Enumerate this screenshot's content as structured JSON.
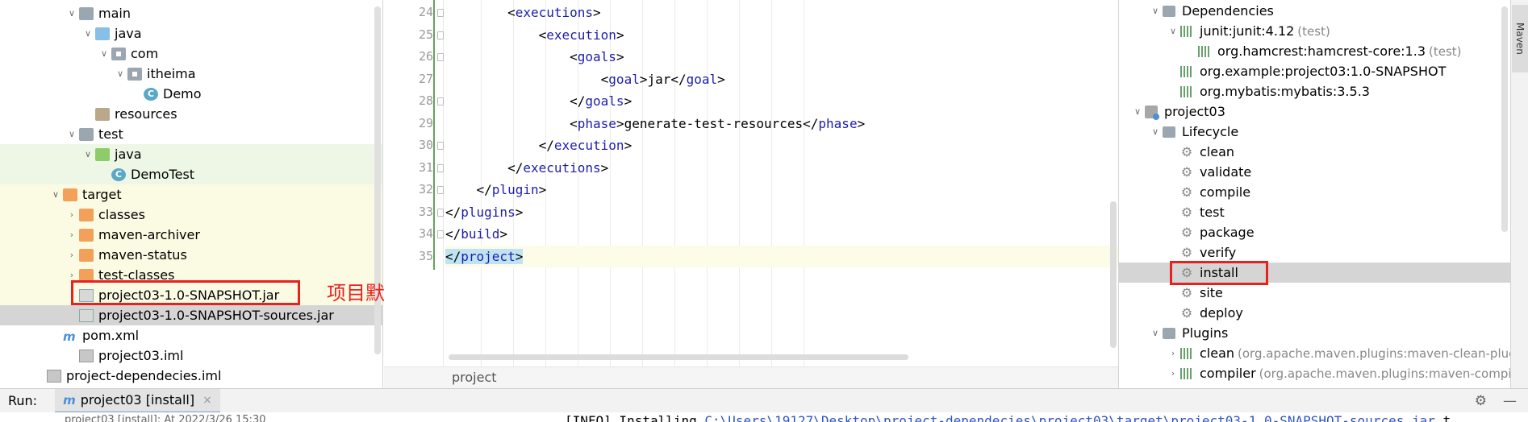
{
  "project_tree": [
    {
      "label": "main",
      "icon": "folder-icon",
      "arrow": "v"
    },
    {
      "label": "java",
      "icon": "source-folder-icon",
      "arrow": "v"
    },
    {
      "label": "com",
      "icon": "package-icon",
      "arrow": "v"
    },
    {
      "label": "itheima",
      "icon": "package-icon",
      "arrow": "v"
    },
    {
      "label": "Demo",
      "icon": "class-icon",
      "arrow": ""
    },
    {
      "label": "resources",
      "icon": "resources-folder-icon",
      "arrow": ""
    },
    {
      "label": "test",
      "icon": "folder-icon",
      "arrow": "v"
    },
    {
      "label": "java",
      "icon": "test-folder-icon",
      "arrow": "v"
    },
    {
      "label": "DemoTest",
      "icon": "class-icon",
      "arrow": ""
    },
    {
      "label": "target",
      "icon": "excluded-folder-icon",
      "arrow": "v"
    },
    {
      "label": "classes",
      "icon": "excluded-folder-icon",
      "arrow": ">"
    },
    {
      "label": "maven-archiver",
      "icon": "excluded-folder-icon",
      "arrow": ">"
    },
    {
      "label": "maven-status",
      "icon": "excluded-folder-icon",
      "arrow": ">"
    },
    {
      "label": "test-classes",
      "icon": "excluded-folder-icon",
      "arrow": ">"
    },
    {
      "label": "project03-1.0-SNAPSHOT.jar",
      "icon": "jar-icon",
      "arrow": ""
    },
    {
      "label": "project03-1.0-SNAPSHOT-sources.jar",
      "icon": "jar-icon",
      "arrow": ""
    },
    {
      "label": "pom.xml",
      "icon": "maven-file-icon",
      "arrow": ""
    },
    {
      "label": "project03.iml",
      "icon": "iml-file-icon",
      "arrow": ""
    },
    {
      "label": "project-dependecies.iml",
      "icon": "iml-file-icon",
      "arrow": ""
    }
  ],
  "annotation": "项目默认打的jar包",
  "editor": {
    "line_numbers": [
      "24",
      "25",
      "26",
      "27",
      "28",
      "29",
      "30",
      "31",
      "32",
      "33",
      "34",
      "35"
    ],
    "lines": [
      {
        "tag_open": "<",
        "name": "executions",
        "tag_close": ">",
        "text": "",
        "end": ""
      },
      {
        "tag_open": "<",
        "name": "execution",
        "tag_close": ">",
        "text": "",
        "end": ""
      },
      {
        "tag_open": "<",
        "name": "goals",
        "tag_close": ">",
        "text": "",
        "end": ""
      },
      {
        "tag_open": "<",
        "name": "goal",
        "tag_close": ">",
        "text": "jar",
        "end": "goal"
      },
      {
        "tag_open": "</",
        "name": "goals",
        "tag_close": ">",
        "text": "",
        "end": ""
      },
      {
        "tag_open": "<",
        "name": "phase",
        "tag_close": ">",
        "text": "generate-test-resources",
        "end": "phase"
      },
      {
        "tag_open": "</",
        "name": "execution",
        "tag_close": ">",
        "text": "",
        "end": ""
      },
      {
        "tag_open": "</",
        "name": "executions",
        "tag_close": ">",
        "text": "",
        "end": ""
      },
      {
        "tag_open": "</",
        "name": "plugin",
        "tag_close": ">",
        "text": "",
        "end": ""
      },
      {
        "tag_open": "</",
        "name": "plugins",
        "tag_close": ">",
        "text": "",
        "end": ""
      },
      {
        "tag_open": "</",
        "name": "build",
        "tag_close": ">",
        "text": "",
        "end": ""
      },
      {
        "tag_open": "</",
        "name": "project",
        "tag_close": ">",
        "text": "",
        "end": ""
      }
    ],
    "breadcrumb": "project",
    "maven_popup_close": "×"
  },
  "maven": {
    "tab_label": "Maven",
    "rows": [
      {
        "label": "Dependencies",
        "suffix": "",
        "icon": "folder-icon",
        "arrow": "v"
      },
      {
        "label": "junit:junit:4.12",
        "suffix": "(test)",
        "icon": "library-icon",
        "arrow": "v"
      },
      {
        "label": "org.hamcrest:hamcrest-core:1.3",
        "suffix": "(test)",
        "icon": "library-icon",
        "arrow": ""
      },
      {
        "label": "org.example:project03:1.0-SNAPSHOT",
        "suffix": "",
        "icon": "library-icon",
        "arrow": ""
      },
      {
        "label": "org.mybatis:mybatis:3.5.3",
        "suffix": "",
        "icon": "library-icon",
        "arrow": ""
      },
      {
        "label": "project03",
        "suffix": "",
        "icon": "maven-project-icon",
        "arrow": "v"
      },
      {
        "label": "Lifecycle",
        "suffix": "",
        "icon": "lifecycle-folder-icon",
        "arrow": "v"
      },
      {
        "label": "clean",
        "suffix": "",
        "icon": "gear-icon",
        "arrow": ""
      },
      {
        "label": "validate",
        "suffix": "",
        "icon": "gear-icon",
        "arrow": ""
      },
      {
        "label": "compile",
        "suffix": "",
        "icon": "gear-icon",
        "arrow": ""
      },
      {
        "label": "test",
        "suffix": "",
        "icon": "gear-icon",
        "arrow": ""
      },
      {
        "label": "package",
        "suffix": "",
        "icon": "gear-icon",
        "arrow": ""
      },
      {
        "label": "verify",
        "suffix": "",
        "icon": "gear-icon",
        "arrow": ""
      },
      {
        "label": "install",
        "suffix": "",
        "icon": "gear-icon",
        "arrow": ""
      },
      {
        "label": "site",
        "suffix": "",
        "icon": "gear-icon",
        "arrow": ""
      },
      {
        "label": "deploy",
        "suffix": "",
        "icon": "gear-icon",
        "arrow": ""
      },
      {
        "label": "Plugins",
        "suffix": "",
        "icon": "plugins-folder-icon",
        "arrow": "v"
      },
      {
        "label": "clean",
        "suffix": "(org.apache.maven.plugins:maven-clean-plugin",
        "icon": "plugin-icon",
        "arrow": ">"
      },
      {
        "label": "compiler",
        "suffix": "(org.apache.maven.plugins:maven-compiler",
        "icon": "plugin-icon",
        "arrow": ">"
      }
    ]
  },
  "run": {
    "label": "Run:",
    "tab": "project03 [install]",
    "tab_close": "×",
    "console_left": "project03 [install]: At 2022/3/26 15:30",
    "console_prefix": "[INFO] Installing ",
    "console_path": "C:\\Users\\19127\\Desktop\\project-dependecies\\project03\\target\\project03-1.0-SNAPSHOT-sources.jar",
    "console_suffix": " t"
  }
}
